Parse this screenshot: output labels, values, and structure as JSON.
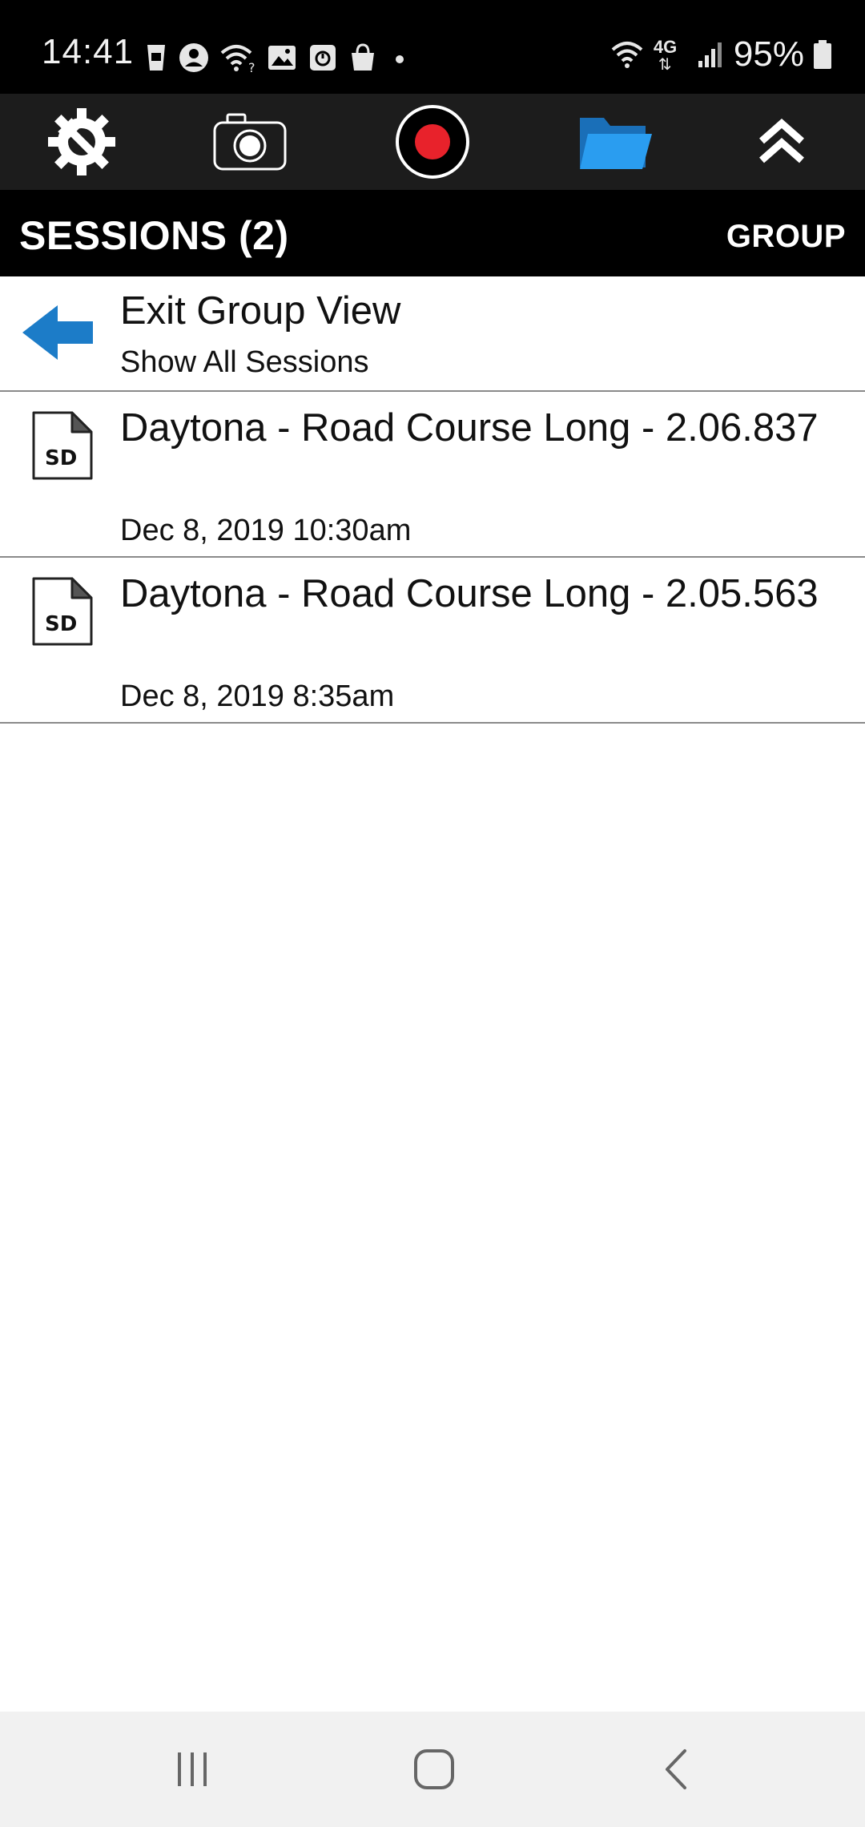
{
  "status_bar": {
    "time": "14:41",
    "battery_percent": "95%",
    "network": "4G",
    "left_icons": [
      "coffee-cup-icon",
      "account-icon",
      "wifi-question-icon",
      "image-icon",
      "timer-app-icon",
      "shopping-bag-icon",
      "dot-icon"
    ],
    "right_icons": [
      "wifi-icon",
      "lte-4g-icon",
      "signal-icon",
      "battery-icon"
    ]
  },
  "toolbar": {
    "items": [
      "settings-wrench-gear-icon",
      "camera-icon",
      "record-icon",
      "folder-icon",
      "collapse-chevrons-icon"
    ],
    "active_item": "folder-icon",
    "colors": {
      "record": "#e8222b",
      "folder_active": "#1e90e6"
    }
  },
  "header": {
    "title": "SESSIONS (2)",
    "action": "GROUP"
  },
  "exit_row": {
    "title": "Exit Group View",
    "subtitle": "Show All Sessions",
    "icon": "back-arrow-icon",
    "icon_color": "#1c7cc8"
  },
  "sessions": [
    {
      "title": "Daytona - Road Course Long - 2.06.837",
      "date": "Dec 8, 2019 10:30am",
      "icon": "sd-file-icon",
      "icon_text": "SD"
    },
    {
      "title": "Daytona - Road Course Long - 2.05.563",
      "date": "Dec 8, 2019 8:35am",
      "icon": "sd-file-icon",
      "icon_text": "SD"
    }
  ],
  "nav_bar": {
    "items": [
      "recent-apps-icon",
      "home-icon",
      "back-icon"
    ]
  }
}
